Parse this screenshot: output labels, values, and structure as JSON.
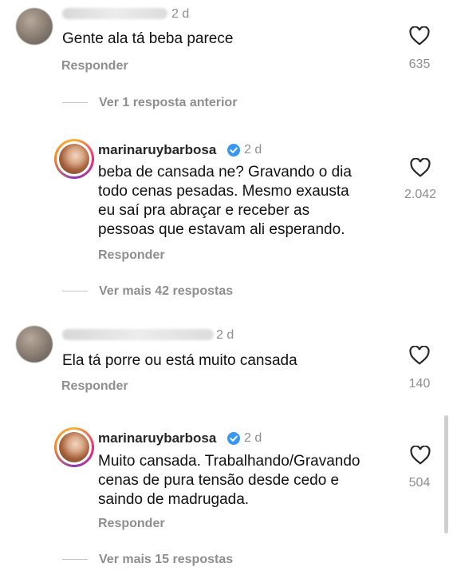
{
  "comments": [
    {
      "time": "2 d",
      "text": "Gente ala tá beba parece",
      "reply": "Responder",
      "likes": "635",
      "icon": "heart-outline"
    },
    {
      "username": "marinaruybarbosa",
      "verified": true,
      "time": "2 d",
      "text_lines": [
        "beba de cansada ne? Gravando o dia",
        "todo cenas pesadas. Mesmo exausta",
        "eu saí pra abraçar e receber as",
        "pessoas que estavam ali esperando."
      ],
      "reply": "Responder",
      "likes": "2.042"
    },
    {
      "time": "2 d",
      "text": "Ela tá porre ou está muito cansada",
      "reply": "Responder",
      "likes": "140"
    },
    {
      "username": "marinaruybarbosa",
      "verified": true,
      "time": "2 d",
      "text_lines": [
        "Muito cansada. Trabalhando/Gravando",
        "cenas de pura tensão desde cedo e",
        "saindo de madrugada."
      ],
      "reply": "Responder",
      "likes": "504"
    }
  ],
  "threads": {
    "previous": "Ver 1 resposta anterior",
    "more_1": "Ver mais 42 respostas",
    "more_2": "Ver mais 15 respostas"
  },
  "colors": {
    "verified": "#3897f0",
    "secondary_text": "#8e8e8e"
  }
}
